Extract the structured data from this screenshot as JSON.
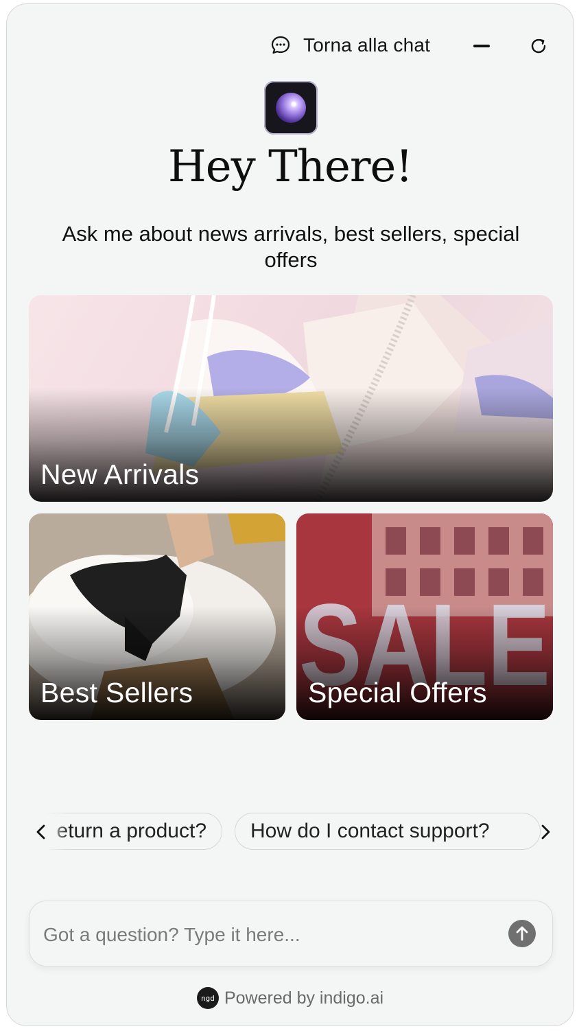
{
  "header": {
    "back_label": "Torna alla chat",
    "back_icon": "chat-bubble-icon",
    "minimize_icon": "minimize-icon",
    "reset_icon": "refresh-icon"
  },
  "hero": {
    "avatar_icon": "assistant-orb-icon",
    "title": "Hey There!",
    "subtitle": "Ask me about news arrivals, best sellers, special offers"
  },
  "cards": [
    {
      "label": "New Arrivals"
    },
    {
      "label": "Best Sellers"
    },
    {
      "label": "Special Offers",
      "image_text": "SALE"
    }
  ],
  "suggestions": [
    {
      "label": "eturn a product?"
    },
    {
      "label": "How do I contact support?"
    }
  ],
  "input": {
    "placeholder": "Got a question? Type it here..."
  },
  "footer": {
    "logo_text": "ngd",
    "powered_by": "Powered by indigo.ai"
  },
  "colors": {
    "panel_bg": "#f4f5f5",
    "send_button": "#707070",
    "text": "#111111"
  }
}
